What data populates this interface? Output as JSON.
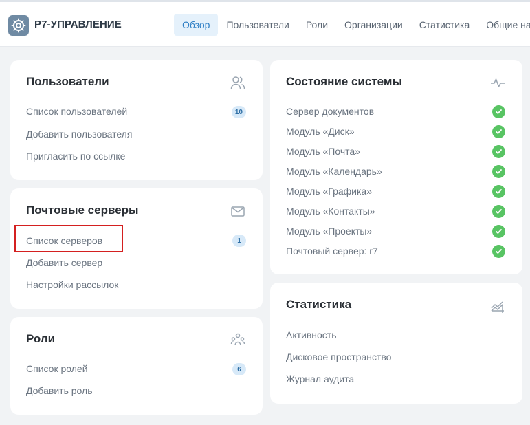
{
  "app": {
    "brand": "Р7-УПРАВЛЕНИЕ"
  },
  "nav": {
    "items": [
      "Обзор",
      "Пользователи",
      "Роли",
      "Организации",
      "Статистика",
      "Общие на"
    ],
    "active": "Обзор"
  },
  "users_card": {
    "title": "Пользователи",
    "icon": "users-icon",
    "links": [
      "Список пользователей",
      "Добавить пользователя",
      "Пригласить по ссылке"
    ],
    "count": "10"
  },
  "mail_card": {
    "title": "Почтовые серверы",
    "icon": "mail-icon",
    "links": [
      "Список серверов",
      "Добавить сервер",
      "Настройки рассылок"
    ],
    "count": "1"
  },
  "roles_card": {
    "title": "Роли",
    "icon": "roles-icon",
    "links": [
      "Список ролей",
      "Добавить роль"
    ],
    "count": "6"
  },
  "system_card": {
    "title": "Состояние системы",
    "icon": "pulse-icon",
    "items": [
      "Сервер документов",
      "Модуль «Диск»",
      "Модуль «Почта»",
      "Модуль «Календарь»",
      "Модуль «Графика»",
      "Модуль «Контакты»",
      "Модуль «Проекты»",
      "Почтовый сервер: r7"
    ],
    "status_icon": "check-icon"
  },
  "stats_card": {
    "title": "Статистика",
    "icon": "chart-icon",
    "links": [
      "Активность",
      "Дисковое пространство",
      "Журнал аудита"
    ]
  },
  "colors": {
    "accent": "#2f7fc5",
    "ok": "#58c463",
    "highlight": "#d42020"
  }
}
